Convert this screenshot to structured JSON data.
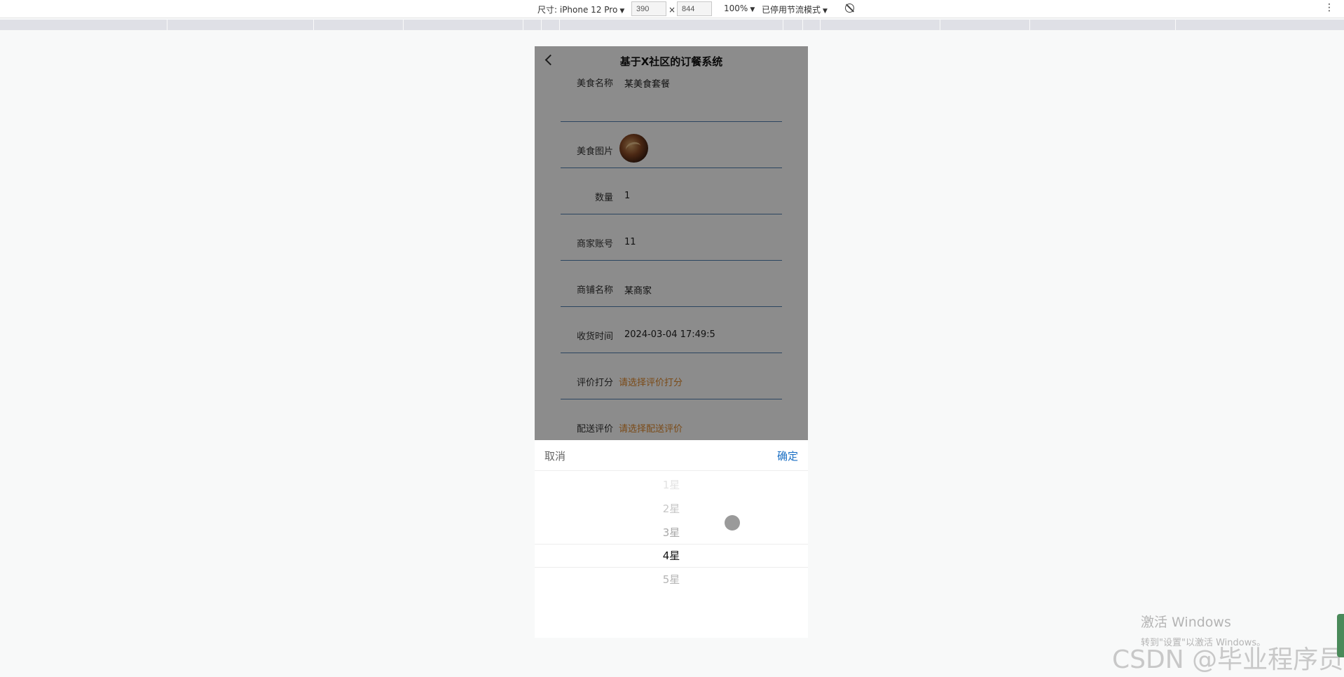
{
  "devtools": {
    "device_label": "尺寸: iPhone 12 Pro",
    "width_value": "390",
    "times": "×",
    "height_value": "844",
    "zoom": "100%",
    "throttle": "已停用节流模式",
    "more": "⋮"
  },
  "app": {
    "title": "基于X社区的订餐系统"
  },
  "form": {
    "rows": [
      {
        "label": "美食名称",
        "value": "某美食套餐"
      },
      {
        "label": "美食图片",
        "value": ""
      },
      {
        "label": "数量",
        "value": "1"
      },
      {
        "label": "商家账号",
        "value": "11"
      },
      {
        "label": "商铺名称",
        "value": "某商家"
      },
      {
        "label": "收货时间",
        "value": "2024-03-04 17:49:5"
      },
      {
        "label": "评价打分",
        "value": "请选择评价打分"
      },
      {
        "label": "配送评价",
        "value": "请选择配送评价"
      }
    ]
  },
  "picker": {
    "cancel": "取消",
    "confirm": "确定",
    "options": [
      "1星",
      "2星",
      "3星",
      "4星",
      "5星"
    ],
    "selected": "4星"
  },
  "watermark": {
    "line1": "激活 Windows",
    "line2": "转到\"设置\"以激活 Windows。",
    "csdn": "CSDN @毕业程序员"
  }
}
